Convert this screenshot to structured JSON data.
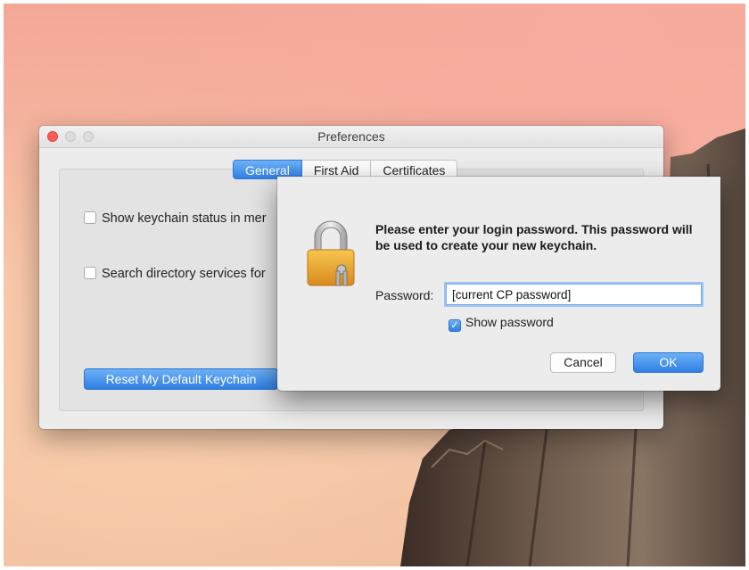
{
  "preferences": {
    "title": "Preferences",
    "tabs": [
      {
        "label": "General",
        "active": true
      },
      {
        "label": "First Aid",
        "active": false
      },
      {
        "label": "Certificates",
        "active": false
      }
    ],
    "options": [
      {
        "label": "Show keychain status in mer",
        "checked": false
      },
      {
        "label": "Search directory services for",
        "checked": false
      }
    ],
    "reset_button": "Reset My Default Keychain"
  },
  "dialog": {
    "message": "Please enter your login password. This password will be used to create your new keychain.",
    "password_label": "Password:",
    "password_value": "[current CP password]",
    "show_password_label": "Show password",
    "show_password_checked": true,
    "cancel_label": "Cancel",
    "ok_label": "OK",
    "icon": "lock-keys-icon"
  },
  "colors": {
    "accent": "#2f7fe3",
    "close_button": "#fc5d57"
  }
}
